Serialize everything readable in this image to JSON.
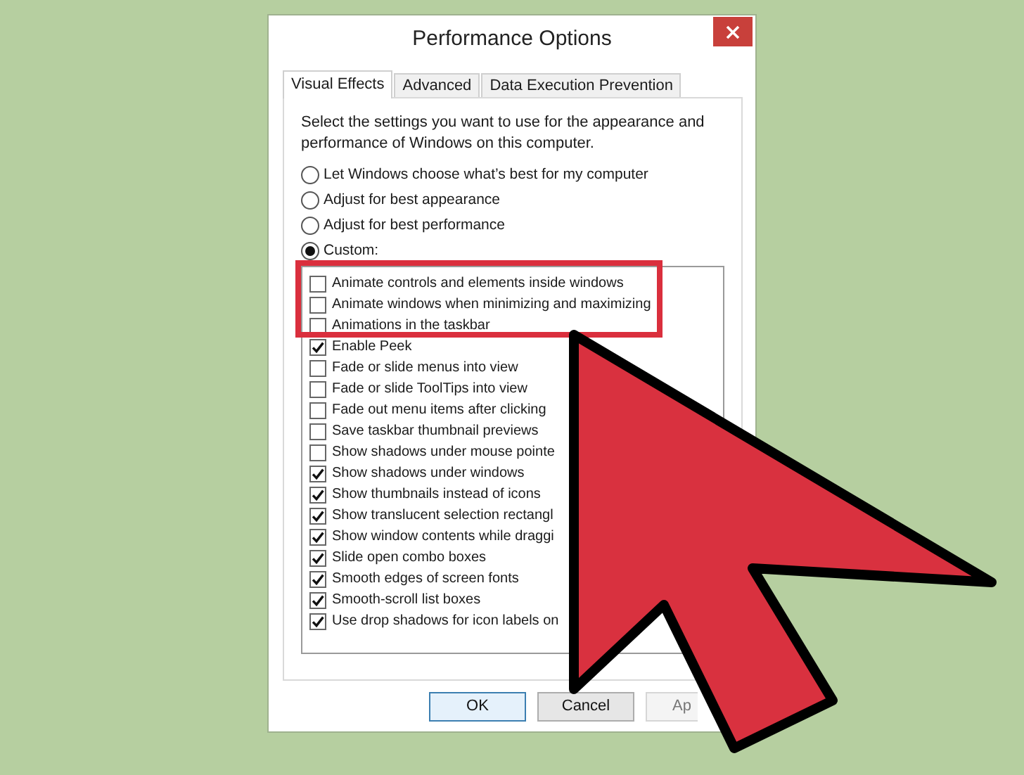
{
  "window": {
    "title": "Performance Options"
  },
  "tabs": [
    {
      "label": "Visual Effects",
      "selected": true
    },
    {
      "label": "Advanced",
      "selected": false
    },
    {
      "label": "Data Execution Prevention",
      "selected": false
    }
  ],
  "description": "Select the settings you want to use for the appearance and performance of Windows on this computer.",
  "options": [
    {
      "label": "Let Windows choose what’s best for my computer",
      "selected": false
    },
    {
      "label": "Adjust for best appearance",
      "selected": false
    },
    {
      "label": "Adjust for best performance",
      "selected": false
    },
    {
      "label": "Custom:",
      "selected": true
    }
  ],
  "effects": [
    {
      "label": "Animate controls and elements inside windows",
      "checked": false
    },
    {
      "label": "Animate windows when minimizing and maximizing",
      "checked": false
    },
    {
      "label": "Animations in the taskbar",
      "checked": false
    },
    {
      "label": "Enable Peek",
      "checked": true
    },
    {
      "label": "Fade or slide menus into view",
      "checked": false
    },
    {
      "label": "Fade or slide ToolTips into view",
      "checked": false
    },
    {
      "label": "Fade out menu items after clicking",
      "checked": false
    },
    {
      "label": "Save taskbar thumbnail previews",
      "checked": false
    },
    {
      "label": "Show shadows under mouse pointe",
      "checked": false
    },
    {
      "label": "Show shadows under windows",
      "checked": true
    },
    {
      "label": "Show thumbnails instead of icons",
      "checked": true
    },
    {
      "label": "Show translucent selection rectangl",
      "checked": true
    },
    {
      "label": "Show window contents while draggi",
      "checked": true
    },
    {
      "label": "Slide open combo boxes",
      "checked": true
    },
    {
      "label": "Smooth edges of screen fonts",
      "checked": true
    },
    {
      "label": "Smooth-scroll list boxes",
      "checked": true
    },
    {
      "label": "Use drop shadows for icon labels on",
      "checked": true
    }
  ],
  "buttons": [
    {
      "label": "OK",
      "kind": "default",
      "disabled": false
    },
    {
      "label": "Cancel",
      "kind": "normal",
      "disabled": false
    },
    {
      "label": "Ap",
      "kind": "normal",
      "disabled": true
    }
  ]
}
